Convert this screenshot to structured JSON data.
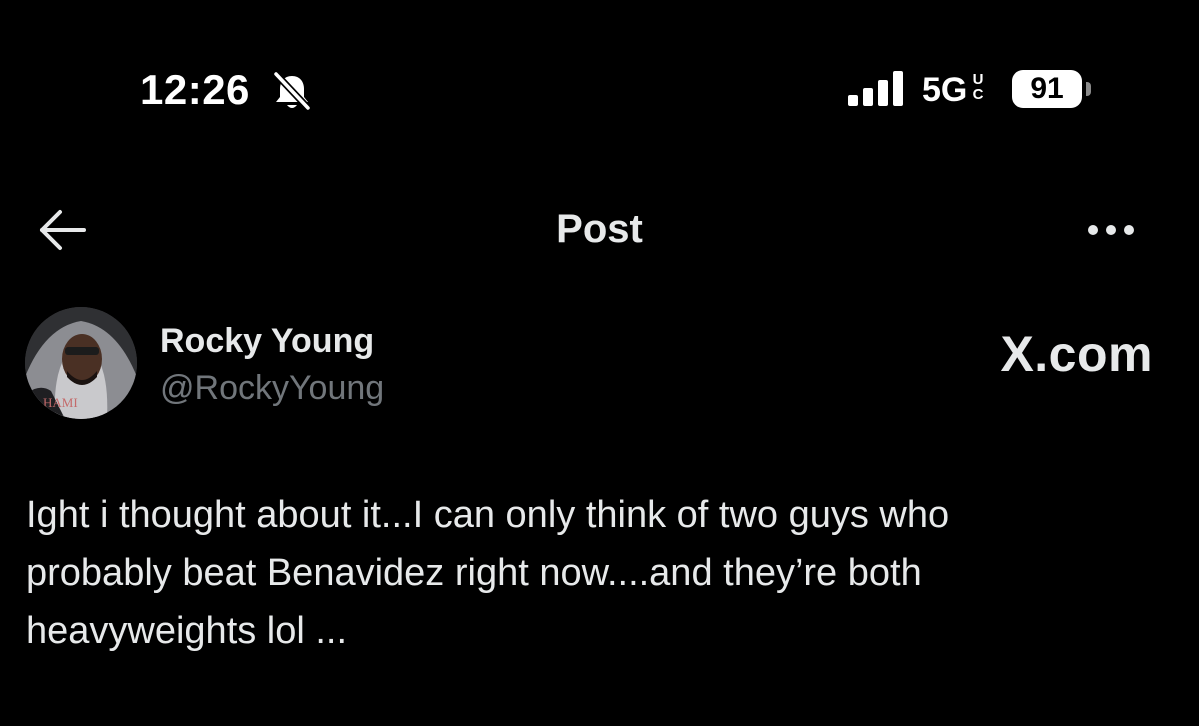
{
  "status_bar": {
    "time": "12:26",
    "network": "5G",
    "network_suffix_top": "U",
    "network_suffix_bottom": "C",
    "battery_level": "91",
    "icons": [
      "bell-slash-icon",
      "signal-bars-icon",
      "battery-icon"
    ]
  },
  "header": {
    "title": "Post",
    "back_icon": "arrow-left-icon",
    "more_icon": "ellipsis-icon"
  },
  "post": {
    "author_name": "Rocky Young",
    "author_handle": "@RockyYoung",
    "avatar_icon": "profile-photo",
    "watermark": "X.com",
    "text_lines": [
      "Ight i thought about it...I can only think of two guys who",
      "probably beat Benavidez right now....and they’re both",
      "heavyweights lol ..."
    ]
  },
  "colors": {
    "background": "#000000",
    "primary_text": "#e7e9ea",
    "secondary_text": "#71767b"
  }
}
